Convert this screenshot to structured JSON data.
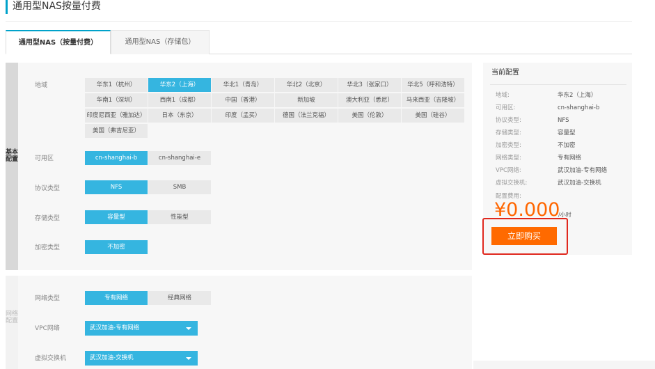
{
  "page_title": "通用型NAS按量付费",
  "tabs": [
    {
      "label": "通用型NAS（按量付费）",
      "active": true
    },
    {
      "label": "通用型NAS（存储包）",
      "active": false
    }
  ],
  "sections": {
    "basic": "基本配置",
    "network": "网络配置"
  },
  "basic": {
    "region_label": "地域",
    "regions": [
      "华东1（杭州）",
      "华东2（上海）",
      "华北1（青岛）",
      "华北2（北京）",
      "华北3（张家口）",
      "华北5（呼和浩特）",
      "华南1（深圳）",
      "西南1（成都）",
      "中国（香港）",
      "新加坡",
      "澳大利亚（悉尼）",
      "马来西亚（吉隆坡）",
      "印度尼西亚（雅加达）",
      "日本（东京）",
      "印度（孟买）",
      "德国（法兰克福）",
      "美国（伦敦）",
      "美国（硅谷）",
      "美国（弗吉尼亚）"
    ],
    "selected_region": "华东2（上海）",
    "zone_label": "可用区",
    "zones": [
      "cn-shanghai-b",
      "cn-shanghai-e"
    ],
    "selected_zone": "cn-shanghai-b",
    "protocol_label": "协议类型",
    "protocols": [
      "NFS",
      "SMB"
    ],
    "selected_protocol": "NFS",
    "storage_label": "存储类型",
    "storage_types": [
      "容量型",
      "性能型"
    ],
    "selected_storage": "容量型",
    "encryption_label": "加密类型",
    "encryption_options": [
      "不加密"
    ],
    "selected_encryption": "不加密"
  },
  "network": {
    "net_type_label": "网络类型",
    "net_types": [
      "专有网络",
      "经典网络"
    ],
    "selected_net_type": "专有网络",
    "vpc_label": "VPC网络",
    "vpc_value": "武汉加油-专有网络",
    "vswitch_label": "虚拟交换机",
    "vswitch_value": "武汉加油-交换机"
  },
  "summary": {
    "title": "当前配置",
    "items": [
      {
        "key": "地域:",
        "value": "华东2（上海）"
      },
      {
        "key": "可用区:",
        "value": "cn-shanghai-b"
      },
      {
        "key": "协议类型:",
        "value": "NFS"
      },
      {
        "key": "存储类型:",
        "value": "容量型"
      },
      {
        "key": "加密类型:",
        "value": "不加密"
      },
      {
        "key": "网络类型:",
        "value": "专有网络"
      },
      {
        "key": "VPC网络:",
        "value": "武汉加油-专有网络"
      },
      {
        "key": "虚拟交换机:",
        "value": "武汉加油-交换机"
      },
      {
        "key": "配置费用:",
        "value": ""
      }
    ],
    "price": "¥0.000",
    "price_unit": "/小时",
    "buy_label": "立即购买"
  },
  "colors": {
    "accent": "#35b5e0",
    "buy": "#ff6a00",
    "price": "#ff6600",
    "highlight": "#e0281e"
  }
}
